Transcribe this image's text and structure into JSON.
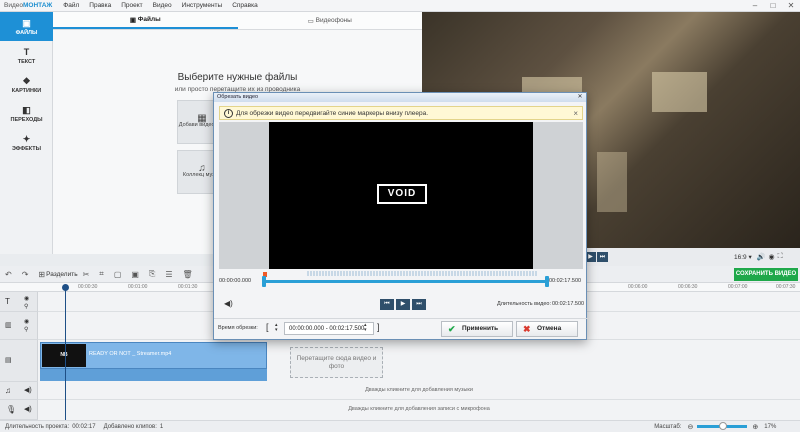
{
  "app": {
    "logo_prefix": "Видео",
    "logo_suffix": "МОНТАЖ"
  },
  "menu": [
    "Файл",
    "Правка",
    "Проект",
    "Видео",
    "Инструменты",
    "Справка"
  ],
  "sidebar": [
    {
      "label": "ФАЙЛЫ",
      "icon": "folder-icon",
      "glyph": "▣"
    },
    {
      "label": "ТЕКСТ",
      "icon": "text-icon",
      "glyph": "T"
    },
    {
      "label": "КАРТИНКИ",
      "icon": "image-icon",
      "glyph": "❖"
    },
    {
      "label": "ПЕРЕХОДЫ",
      "icon": "transitions-icon",
      "glyph": "◧"
    },
    {
      "label": "ЭФФЕКТЫ",
      "icon": "effects-icon",
      "glyph": "✦"
    }
  ],
  "files_panel": {
    "tabs": [
      "Файлы",
      "Видеофоны"
    ],
    "title": "Выберите нужные файлы",
    "subtitle": "или просто перетащите их из проводника",
    "card1": "Добави видео и ф",
    "card2": "Коллекц музык"
  },
  "preview": {
    "aspect": "16:9 ▾"
  },
  "toolbar": {
    "split_label": "Разделить",
    "save_label": "СОХРАНИТЬ ВИДЕО"
  },
  "ruler": [
    "00:00:30",
    "00:01:00",
    "00:01:30",
    "00:06:00",
    "00:06:30",
    "00:07:00",
    "00:07:30"
  ],
  "timeline": {
    "clip_label": "READY OR NOT _ Streamer.mp4",
    "clip_thumb": "NB",
    "drop_hint": "Перетащите сюда видео и фото",
    "music_hint": "Дважды кликните для добавления музыки",
    "mic_hint": "Дважды кликните для добавления записи с микрофона"
  },
  "status": {
    "duration_label": "Длительность проекта:",
    "duration_value": "00:02:17",
    "clips_label": "Добавлено клипов:",
    "clips_value": "1",
    "zoom_label": "Масштаб:",
    "zoom_value": "17%"
  },
  "dialog": {
    "title": "Обрезать видео",
    "info": "Для обрезки видео передвигайте синие маркеры внизу плеера.",
    "logo": "VOID",
    "start_tc": "00:00:00.000",
    "end_tc": "00:02:17.500",
    "duration_label": "Длительность видео:",
    "duration_value": "00:02:17.500",
    "trim_label": "Время обрезки:",
    "trim_value": "00:00:00.000 - 00:02:17.500",
    "apply": "Применить",
    "cancel": "Отмена"
  }
}
